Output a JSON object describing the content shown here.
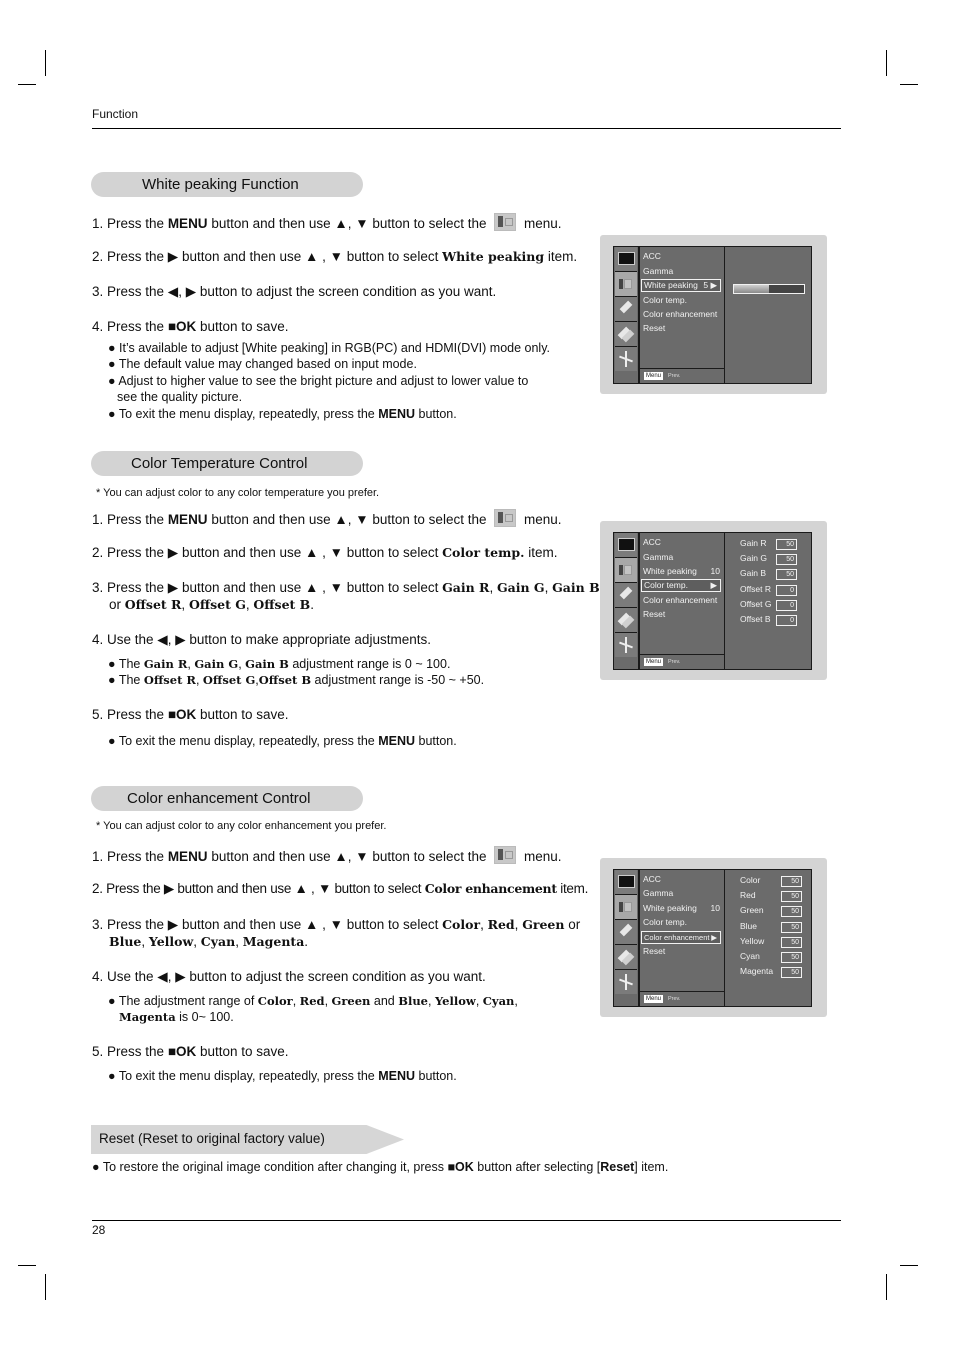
{
  "header": {
    "running_head": "Function"
  },
  "footer": {
    "page_number": "28"
  },
  "glyphs": {
    "up": "▲",
    "down": "▼",
    "left": "◀",
    "right": "▶",
    "ok_square": "■",
    "bullet": "●"
  },
  "white_peaking": {
    "title": "White peaking Function",
    "steps": [
      {
        "num": "1.",
        "pre": "Press the ",
        "b1": "MENU",
        "mid": " button and then use ▲, ▼ button to select the ",
        "post": " menu."
      },
      {
        "num": "2.",
        "pre": "Press the ▶ button and then use ▲ , ▼ button to select ",
        "b1": "White peaking",
        "post": " item."
      },
      {
        "num": "3.",
        "text": "Press the ◀, ▶ button to adjust the screen condition as you want."
      },
      {
        "num": "4.",
        "pre": "Press the ",
        "b1": "■OK",
        "post": " button to save."
      }
    ],
    "bullets": [
      "It’s available to adjust [White peaking] in RGB(PC) and HDMI(DVI) mode only.",
      "The default value may changed based on input mode.",
      "Adjust  to higher value to see the bright picture and adjust to lower value to",
      "see the quality picture."
    ],
    "exit_bullet": {
      "pre": "To exit the menu display, repeatedly, press the ",
      "b1": "MENU",
      "post": " button."
    }
  },
  "color_temp": {
    "title": "Color Temperature Control",
    "note": "* You can adjust color to any color temperature you prefer.",
    "steps": [
      {
        "num": "1.",
        "pre": "Press the ",
        "b1": "MENU",
        "mid": " button and then use ▲, ▼ button to select the ",
        "post": " menu."
      },
      {
        "num": "2.",
        "pre": "Press the ▶ button and then use ▲ , ▼ button to select ",
        "b1": "Color temp.",
        "post": " item."
      },
      {
        "num": "3.",
        "pre": "Press the ▶ button and then use ▲ , ▼ button to select ",
        "b1": "Gain R",
        "s1": ", ",
        "b2": "Gain G",
        "s2": ", ",
        "b3": "Gain B"
      },
      {
        "cont_pre": "or ",
        "b1": "Offset R",
        "s1": ", ",
        "b2": "Offset G",
        "s2": ", ",
        "b3": "Offset B",
        "post": "."
      },
      {
        "num": "4.",
        "text": "Use the ◀, ▶ button to make appropriate adjustments."
      },
      {
        "num": "5.",
        "pre": "Press the ",
        "b1": "■OK",
        "post": " button to save."
      }
    ],
    "bullets": [
      {
        "pre": "The ",
        "b1": "Gain R",
        "s1": ", ",
        "b2": "Gain G",
        "s2": ", ",
        "b3": "Gain B",
        "post": " adjustment range is 0 ~ 100."
      },
      {
        "pre": "The ",
        "b1": "Offset R",
        "s1": ", ",
        "b2": "Offset G",
        "s2": ",",
        "b3": "Offset B",
        "post": " adjustment range is -50 ~ +50."
      }
    ],
    "exit_bullet": {
      "pre": "To exit the menu display, repeatedly, press the ",
      "b1": "MENU",
      "post": " button."
    }
  },
  "color_enh": {
    "title": "Color enhancement Control",
    "note": "* You can adjust color to any color enhancement you prefer.",
    "steps": [
      {
        "num": "1.",
        "pre": "Press the ",
        "b1": "MENU",
        "mid": " button and then use ▲, ▼ button to select the ",
        "post": " menu."
      },
      {
        "num": "2.",
        "pre": "Press the ▶ button and then use ▲ , ▼ button to select ",
        "b1": "Color enhancement",
        "post": " item."
      },
      {
        "num": "3.",
        "pre": "Press the ▶ button and then use ▲ , ▼ button to select ",
        "b1": "Color",
        "s1": ", ",
        "b2": "Red",
        "s2": ", ",
        "b3": "Green",
        "post": " or"
      },
      {
        "b1": "Blue",
        "s1": ", ",
        "b2": "Yellow",
        "s2": ", ",
        "b3": "Cyan",
        "s3": ", ",
        "b4": "Magenta",
        "post": "."
      },
      {
        "num": "4.",
        "text": "Use the ◀, ▶ button to adjust the screen condition as you want."
      },
      {
        "num": "5.",
        "pre": "Press the ",
        "b1": "■OK",
        "post": " button to save."
      }
    ],
    "bullets": [
      {
        "pre": "The adjustment range of ",
        "b1": "Color",
        "s1": ", ",
        "b2": "Red",
        "s2": ", ",
        "b3": "Green",
        "s3": " and ",
        "b4": "Blue",
        "s4": ", ",
        "b5": "Yellow",
        "s5": ", ",
        "b6": "Cyan",
        "s6": ","
      },
      {
        "b1": "Magenta",
        "post": " is 0~ 100."
      }
    ],
    "exit_bullet": {
      "pre": "To exit the menu display, repeatedly, press the ",
      "b1": "MENU",
      "post": " button."
    }
  },
  "reset": {
    "title": "Reset (Reset to original factory value)",
    "bullet": {
      "pre": "To restore the original image condition after changing it, press ",
      "b1": "■OK",
      "mid": " button after selecting [",
      "b2": "Reset",
      "post": "] item."
    }
  },
  "osd_common": {
    "menu_items": [
      "ACC",
      "Gamma",
      "White peaking",
      "Color temp.",
      "Color enhancement",
      "Reset"
    ],
    "menu_button": "Menu",
    "prev_label": "Prev.",
    "icons": [
      "picture-icon",
      "screen-menu-icon",
      "tag-icon",
      "double-tag-icon",
      "tools-icon"
    ]
  },
  "osd_white_peaking": {
    "selected_item": "White peaking",
    "selected_value": "5",
    "arrow": "▶",
    "gauge_fraction": 0.5
  },
  "osd_color_temp": {
    "white_peaking_value": "10",
    "selected_item": "Color temp.",
    "arrow": "▶",
    "rows": [
      {
        "label": "Gain R",
        "value": "50"
      },
      {
        "label": "Gain G",
        "value": "50"
      },
      {
        "label": "Gain B",
        "value": "50"
      },
      {
        "label": "Offset R",
        "value": "0"
      },
      {
        "label": "Offset G",
        "value": "0"
      },
      {
        "label": "Offset B",
        "value": "0"
      }
    ]
  },
  "osd_color_enh": {
    "white_peaking_value": "10",
    "selected_item": "Color enhancement",
    "arrow": "▶",
    "rows": [
      {
        "label": "Color",
        "value": "50"
      },
      {
        "label": "Red",
        "value": "50"
      },
      {
        "label": "Green",
        "value": "50"
      },
      {
        "label": "Blue",
        "value": "50"
      },
      {
        "label": "Yellow",
        "value": "50"
      },
      {
        "label": "Cyan",
        "value": "50"
      },
      {
        "label": "Magenta",
        "value": "50"
      }
    ]
  }
}
